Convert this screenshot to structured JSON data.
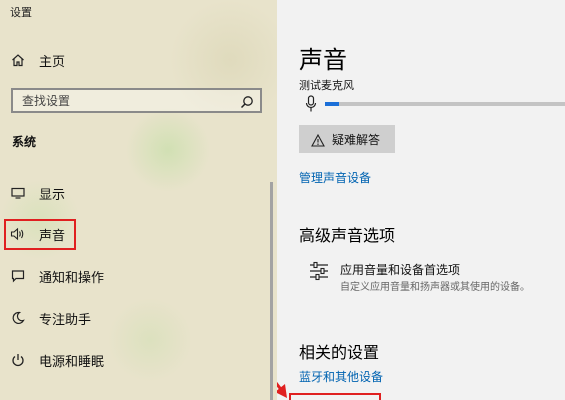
{
  "window": {
    "title": "设置"
  },
  "sidebar": {
    "home_label": "主页",
    "search_placeholder": "查找设置",
    "section_label": "系统",
    "items": [
      {
        "label": "显示",
        "icon": "monitor-icon"
      },
      {
        "label": "声音",
        "icon": "speaker-icon",
        "selected": true
      },
      {
        "label": "通知和操作",
        "icon": "notification-icon"
      },
      {
        "label": "专注助手",
        "icon": "moon-icon"
      },
      {
        "label": "电源和睡眠",
        "icon": "power-icon"
      }
    ]
  },
  "main": {
    "title": "声音",
    "mic_label": "测试麦克风",
    "mic_level_fraction": 0.06,
    "troubleshoot_label": "疑难解答",
    "manage_devices_link": "管理声音设备",
    "advanced_heading": "高级声音选项",
    "advanced_item_title": "应用音量和设备首选项",
    "advanced_item_desc": "自定义应用音量和扬声器或其使用的设备。",
    "related_heading": "相关的设置",
    "bluetooth_link": "蓝牙和其他设备"
  },
  "colors": {
    "accent": "#1b6fd8",
    "link": "#0063b1",
    "highlight": "#e02020"
  }
}
